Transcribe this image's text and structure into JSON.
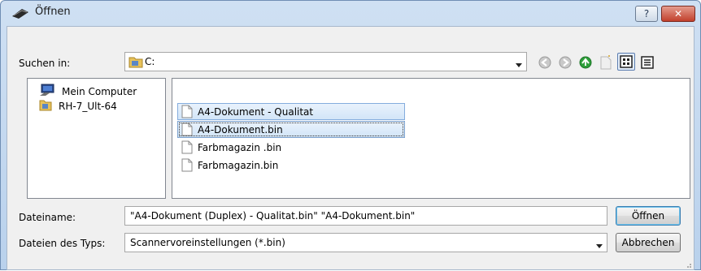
{
  "window": {
    "title": "Öffnen",
    "help_label": "?",
    "close_label": "✕"
  },
  "location": {
    "label": "Suchen in:",
    "value": "C:"
  },
  "toolbar": {
    "icons": [
      "back-icon",
      "forward-icon",
      "up-folder-icon",
      "new-folder-icon",
      "icon-view-icon",
      "list-view-icon"
    ]
  },
  "places": [
    {
      "label": "Mein Computer",
      "icon": "computer-icon"
    },
    {
      "label": "RH-7_Ult-64",
      "icon": "user-folder-icon"
    }
  ],
  "files": [
    {
      "name": "A4-Dokument - Qualitat",
      "state": "selected"
    },
    {
      "name": "A4-Dokument.bin",
      "state": "focused"
    },
    {
      "name": "Farbmagazin .bin",
      "state": "normal"
    },
    {
      "name": "Farbmagazin.bin",
      "state": "normal"
    }
  ],
  "filename": {
    "label": "Dateiname:",
    "value": "\"A4-Dokument (Duplex) - Qualitat.bin\" \"A4-Dokument.bin\""
  },
  "filetype": {
    "label": "Dateien des Typs:",
    "value": "Scannervoreinstellungen (*.bin)"
  },
  "buttons": {
    "open": "Öffnen",
    "cancel": "Abbrechen"
  },
  "colors": {
    "title_gradient_top": "#cfe0f3",
    "selection_border": "#84acdd",
    "close_red": "#c2402c",
    "up_arrow_green": "#2e9f3a"
  }
}
